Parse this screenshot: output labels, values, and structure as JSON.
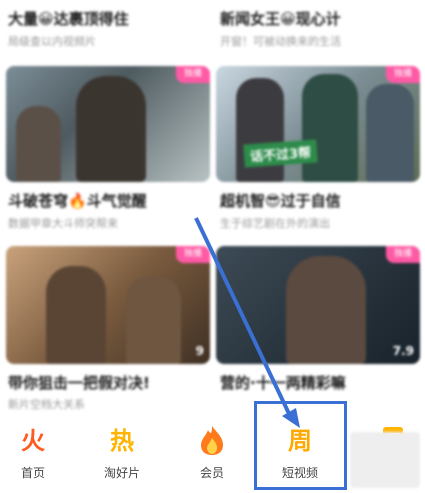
{
  "top_row": [
    {
      "title": "大量😀达裹顶得住",
      "subtitle": "局级查以内视频片"
    },
    {
      "title": "新闻女王😀现心计",
      "subtitle": "开窗！可被动换来的生活"
    }
  ],
  "middle_row": [
    {
      "title": "斗破苍穹🔥斗气觉醒",
      "subtitle": "数据甲章大斗师突帮来",
      "badge": "独播"
    },
    {
      "title": "超机智😎过于自信",
      "subtitle": "生于综艺剧在外的演出",
      "badge": "独播",
      "caption": "话不过3帮"
    }
  ],
  "bottom_row": [
    {
      "title": "带你狙击一把假对决!",
      "subtitle": "新片空档大关系",
      "badge": "独播",
      "duration": "9"
    },
    {
      "title": "营的·十一两精彩嘛",
      "subtitle": "",
      "badge": "独播",
      "duration": "7.9"
    }
  ],
  "tabs": [
    {
      "label": "首页",
      "icon": "fire-icon",
      "glyph": "火",
      "color": "#ff5a1f"
    },
    {
      "label": "淘好片",
      "icon": "hot-icon",
      "glyph": "热",
      "color": "#ffb400"
    },
    {
      "label": "会员",
      "icon": "flame-member-icon",
      "glyph": "",
      "color": "#ff7a1a"
    },
    {
      "label": "短视频",
      "icon": "week-icon",
      "glyph": "周",
      "color": "#ffa800"
    },
    {
      "label": "",
      "icon": "book-icon",
      "glyph": "",
      "color": "#ffb400"
    }
  ],
  "colors": {
    "accent": "#ff5aa5",
    "annotation": "#3a6fd3"
  }
}
